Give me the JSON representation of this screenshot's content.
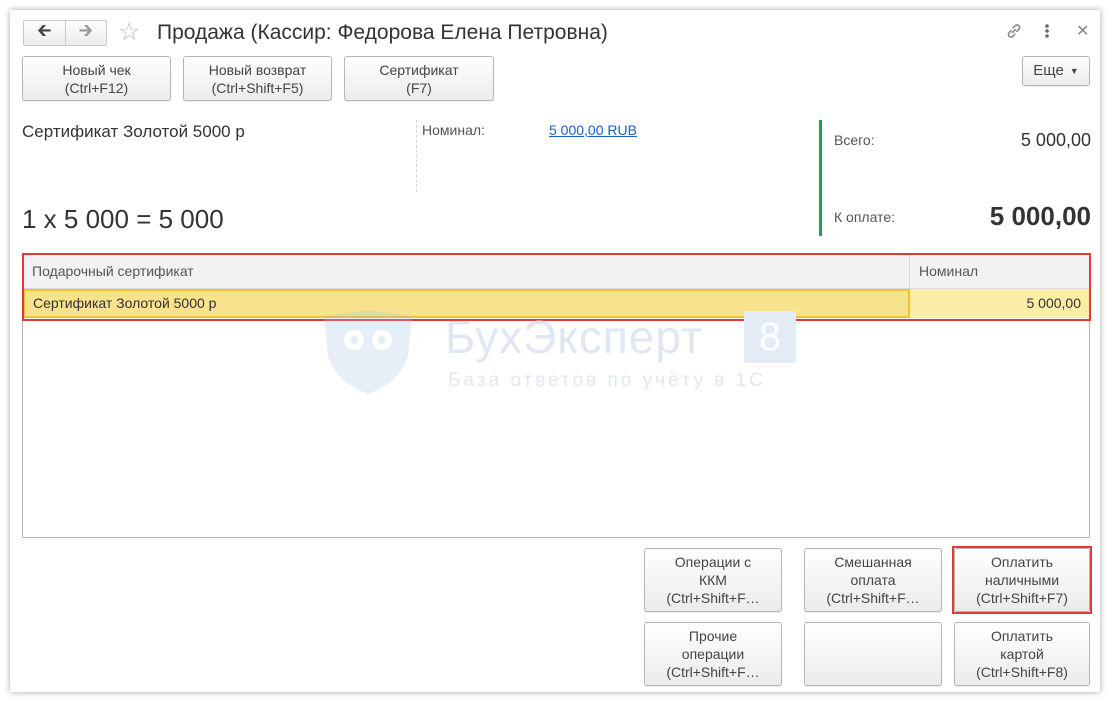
{
  "window": {
    "title": "Продажа (Кассир: Федорова Елена Петровна)",
    "back_icon": "arrow-left-icon",
    "forward_icon": "arrow-right-icon",
    "favorite_icon": "star-icon",
    "link_icon": "link-icon",
    "more_icon": "vertical-dots-icon",
    "close_icon": "close-icon"
  },
  "toolbar": {
    "new_check": {
      "line1": "Новый чек",
      "line2": "(Ctrl+F12)"
    },
    "new_return": {
      "line1": "Новый возврат",
      "line2": "(Ctrl+Shift+F5)"
    },
    "certificate": {
      "line1": "Сертификат",
      "line2": "(F7)"
    },
    "more_label": "Еще"
  },
  "info": {
    "product_name": "Сертификат Золотой 5000 р",
    "nominal_label": "Номинал:",
    "nominal_value": "5 000,00 RUB",
    "formula": "1 x 5 000 = 5 000",
    "total_label": "Всего:",
    "total_value": "5 000,00",
    "to_pay_label": "К оплате:",
    "to_pay_value": "5 000,00"
  },
  "table": {
    "columns": [
      "Подарочный сертификат",
      "Номинал"
    ],
    "rows": [
      {
        "certificate": "Сертификат Золотой 5000 р",
        "nominal": "5 000,00"
      }
    ]
  },
  "watermark": {
    "brand": "БухЭксперт",
    "digit": "8",
    "subtitle": "База ответов по учёту в 1С"
  },
  "actions": {
    "kkm_ops": {
      "line1": "Операции с",
      "line2": "ККМ",
      "line3": "(Ctrl+Shift+F…"
    },
    "mixed_pay": {
      "line1": "Смешанная",
      "line2": "оплата",
      "line3": "(Ctrl+Shift+F…"
    },
    "pay_cash": {
      "line1": "Оплатить",
      "line2": "наличными",
      "line3": "(Ctrl+Shift+F7)"
    },
    "other_ops": {
      "line1": "Прочие",
      "line2": "операции",
      "line3": "(Ctrl+Shift+F…"
    },
    "pay_card": {
      "line1": "Оплатить",
      "line2": "картой",
      "line3": "(Ctrl+Shift+F8)"
    }
  },
  "colors": {
    "accent_green": "#19a34a",
    "highlight_red": "#e53935",
    "row_selected": "#f8e28b",
    "link_blue": "#1a5ec7"
  }
}
